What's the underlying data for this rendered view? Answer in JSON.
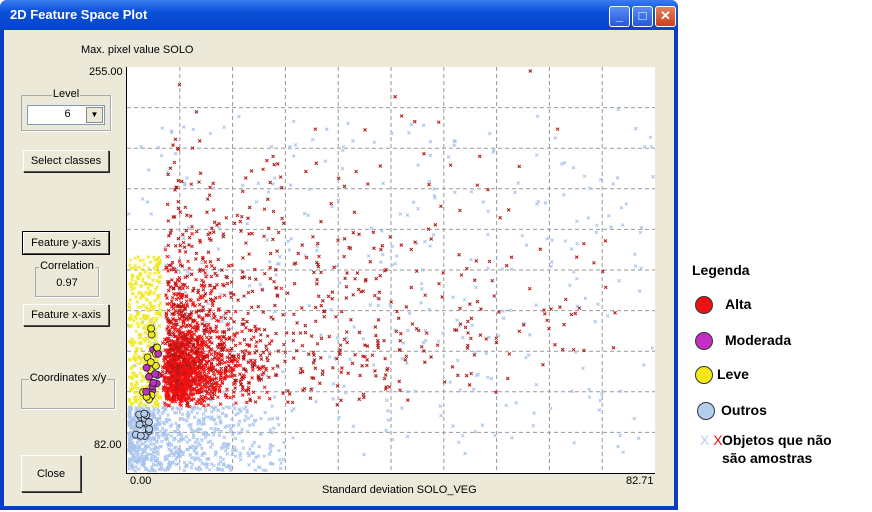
{
  "window": {
    "title": "2D Feature Space Plot"
  },
  "left_panel": {
    "level_label": "Level",
    "level_value": "6",
    "select_classes": "Select classes",
    "feature_y": "Feature y-axis",
    "correlation_label": "Correlation",
    "correlation_value": "0.97",
    "feature_x": "Feature x-axis",
    "coordinates_label": "Coordinates x/y",
    "coordinates_value": "",
    "close": "Close"
  },
  "plot": {
    "y_axis_label": "Max. pixel value SOLO",
    "x_axis_label": "Standard deviation SOLO_VEG",
    "y_max": "255.00",
    "y_min": "82.00",
    "x_min": "0.00",
    "x_max": "82.71",
    "colors": {
      "alta": "#ee1111",
      "alta_x": "#b01818",
      "moderada": "#c030c0",
      "leve": "#f0e820",
      "outros": "#a8c4ec"
    }
  },
  "legend": {
    "title": "Legenda",
    "items": [
      {
        "label": "Alta",
        "color": "#ee1111"
      },
      {
        "label": "Moderada",
        "color": "#c22fc2"
      },
      {
        "label": "Leve",
        "color": "#f5e61c"
      },
      {
        "label": "Outros",
        "color": "#b4cdee"
      }
    ],
    "x_marks": [
      "X",
      "X"
    ],
    "x_colors": [
      "#b4cdee",
      "#ee1111"
    ],
    "non_sample_line1": "Objetos que não",
    "non_sample_line2": "são amostras"
  }
}
